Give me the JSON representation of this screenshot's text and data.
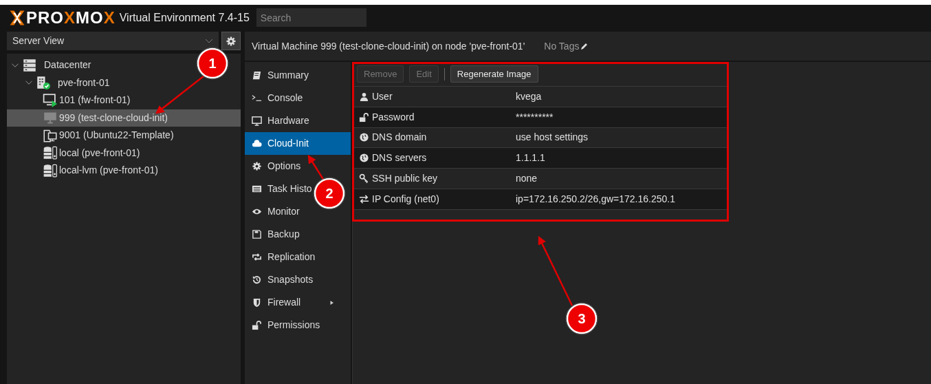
{
  "header": {
    "logo_parts": [
      {
        "text": "PRO",
        "accent": false
      },
      {
        "text": "X",
        "accent": true
      },
      {
        "text": "MO",
        "accent": false
      },
      {
        "text": "X",
        "accent": true
      }
    ],
    "product": "Virtual Environment 7.4-15",
    "search": {
      "placeholder": "Search"
    }
  },
  "view_selector": {
    "value": "Server View"
  },
  "tree": [
    {
      "label": "Datacenter",
      "kind": "datacenter",
      "selected": false,
      "expanded": true,
      "children": [
        {
          "label": "pve-front-01",
          "kind": "node",
          "selected": false,
          "expanded": true,
          "children": [
            {
              "label": "101 (fw-front-01)",
              "kind": "vm-running",
              "selected": false
            },
            {
              "label": "999 (test-clone-cloud-init)",
              "kind": "vm-stopped",
              "selected": true
            },
            {
              "label": "9001 (Ubuntu22-Template)",
              "kind": "template",
              "selected": false
            },
            {
              "label": "local (pve-front-01)",
              "kind": "storage",
              "selected": false
            },
            {
              "label": "local-lvm (pve-front-01)",
              "kind": "storage",
              "selected": false
            }
          ]
        }
      ]
    }
  ],
  "content_title": "Virtual Machine 999 (test-clone-cloud-init) on node 'pve-front-01'",
  "tags": "No Tags",
  "menu": [
    {
      "label": "Summary",
      "selected": false
    },
    {
      "label": "Console",
      "selected": false
    },
    {
      "label": "Hardware",
      "selected": false
    },
    {
      "label": "Cloud-Init",
      "selected": true
    },
    {
      "label": "Options",
      "selected": false
    },
    {
      "label": "Task Histo",
      "selected": false
    },
    {
      "label": "Monitor",
      "selected": false
    },
    {
      "label": "Backup",
      "selected": false
    },
    {
      "label": "Replication",
      "selected": false
    },
    {
      "label": "Snapshots",
      "selected": false
    },
    {
      "label": "Firewall",
      "selected": false,
      "submenu": true
    },
    {
      "label": "Permissions",
      "selected": false
    }
  ],
  "toolbar": [
    {
      "label": "Remove",
      "disabled": true
    },
    {
      "label": "Edit",
      "disabled": true
    },
    {
      "label": "Regenerate Image",
      "disabled": false
    }
  ],
  "rows": [
    {
      "key": "User",
      "value": "kvega"
    },
    {
      "key": "Password",
      "value": "**********"
    },
    {
      "key": "DNS domain",
      "value": "use host settings"
    },
    {
      "key": "DNS servers",
      "value": "1.1.1.1"
    },
    {
      "key": "SSH public key",
      "value": "none"
    },
    {
      "key": "IP Config (net0)",
      "value": "ip=172.16.250.2/26,gw=172.16.250.1"
    }
  ],
  "callouts": [
    {
      "number": "1"
    },
    {
      "number": "2"
    },
    {
      "number": "3"
    }
  ]
}
